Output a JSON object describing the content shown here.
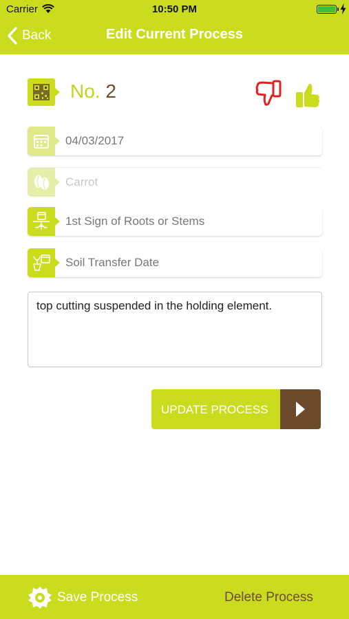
{
  "status_bar": {
    "carrier": "Carrier",
    "time": "10:50 PM",
    "battery_level": 1.0
  },
  "nav": {
    "back_label": "Back",
    "title": "Edit Current Process"
  },
  "process": {
    "number_label": "No.",
    "number_value": "2"
  },
  "fields": {
    "date": "04/03/2017",
    "plant": "Carrot",
    "roots_placeholder": "1st Sign of Roots or Stems",
    "soil_placeholder": "Soil Transfer Date"
  },
  "notes": {
    "value": "top cutting suspended in the holding element."
  },
  "actions": {
    "update_label": "UPDATE PROCESS",
    "save_label": "Save Process",
    "delete_label": "Delete Process"
  },
  "colors": {
    "brand": "#cbdb1e",
    "accent_brown": "#6c4b2c",
    "thumb_down": "#e32020"
  },
  "icons": [
    "chevron-left-icon",
    "qr-code-icon",
    "thumb-down-icon",
    "thumb-up-icon",
    "calendar-icon",
    "seed-icon",
    "roots-icon",
    "soil-transfer-icon",
    "play-arrow-icon",
    "save-icon"
  ]
}
